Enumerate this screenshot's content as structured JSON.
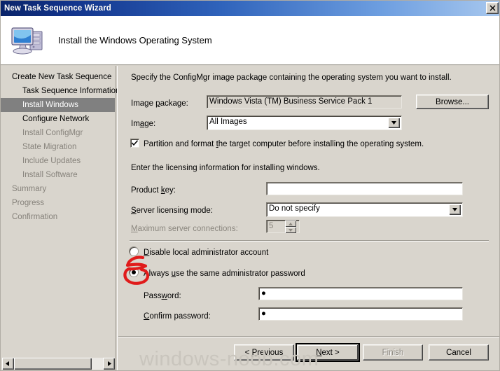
{
  "window": {
    "title": "New Task Sequence Wizard",
    "close_label": "✕",
    "header_title": "Install the Windows Operating System",
    "header_icon": "computer-icon"
  },
  "sidebar": {
    "items": [
      {
        "label": "Create New Task Sequence",
        "state": "normal",
        "indent": false
      },
      {
        "label": "Task Sequence Information",
        "state": "normal",
        "indent": true
      },
      {
        "label": "Install Windows",
        "state": "active",
        "indent": true
      },
      {
        "label": "Configure Network",
        "state": "normal",
        "indent": true
      },
      {
        "label": "Install ConfigMgr",
        "state": "dim",
        "indent": true
      },
      {
        "label": "State Migration",
        "state": "dim",
        "indent": true
      },
      {
        "label": "Include Updates",
        "state": "dim",
        "indent": true
      },
      {
        "label": "Install Software",
        "state": "dim",
        "indent": true
      },
      {
        "label": "Summary",
        "state": "dim",
        "indent": false
      },
      {
        "label": "Progress",
        "state": "dim",
        "indent": false
      },
      {
        "label": "Confirmation",
        "state": "dim",
        "indent": false
      }
    ],
    "scrollbar": {
      "left_arrow": "scroll-left-icon",
      "right_arrow": "scroll-right-icon"
    }
  },
  "main": {
    "intro_text": "Specify the ConfigMgr image package containing the operating system you want to install.",
    "image_package_label": "Image package:",
    "image_package_value": "Windows Vista (TM) Business Service Pack 1",
    "browse_button": "Browse...",
    "image_label": "Image:",
    "image_value": "All Images",
    "partition_checkbox_label": "Partition and format the target computer before installing the operating system.",
    "partition_checked": true,
    "licensing_intro": "Enter the licensing information for installing windows.",
    "product_key_label": "Product key:",
    "product_key_value": "",
    "server_licensing_label": "Server licensing mode:",
    "server_licensing_value": "Do not specify",
    "max_connections_label": "Maximum server connections:",
    "max_connections_value": "5",
    "radio_disable_label": "Disable local administrator account",
    "radio_always_label": "Always use the same administrator password",
    "radio_selected": "always",
    "password_label": "Password:",
    "password_value": "●",
    "confirm_password_label": "Confirm password:",
    "confirm_password_value": "●"
  },
  "footer": {
    "previous_button": "< Previous",
    "next_button": "Next >",
    "finish_button": "Finish",
    "cancel_button": "Cancel",
    "next_is_default": true,
    "finish_disabled": true
  },
  "watermark": "windows-noob.com",
  "colors": {
    "titlebar_start": "#0a246a",
    "titlebar_end": "#a8c8ee",
    "dialog_face": "#d9d5cd",
    "button_face": "#d4d0c8",
    "selection": "#808080",
    "annotation": "#e01b1b",
    "disabled_text": "#8b877f",
    "watermark": "#c9c5bd"
  }
}
